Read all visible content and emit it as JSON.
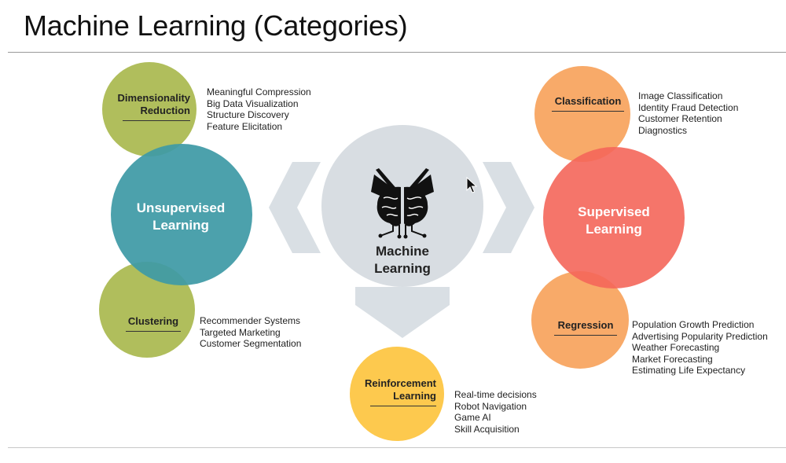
{
  "header": {
    "title": "Machine Learning (Categories)"
  },
  "center": {
    "label_line1": "Machine",
    "label_line2": "Learning",
    "icon": "brain-book-icon"
  },
  "unsupervised": {
    "label_line1": "Unsupervised",
    "label_line2": "Learning",
    "dimensionality": {
      "label_line1": "Dimensionality",
      "label_line2": "Reduction",
      "items": [
        "Meaningful Compression",
        "Big Data Visualization",
        "Structure Discovery",
        "Feature Elicitation"
      ]
    },
    "clustering": {
      "label": "Clustering",
      "items": [
        "Recommender Systems",
        "Targeted Marketing",
        "Customer Segmentation"
      ]
    }
  },
  "supervised": {
    "label_line1": "Supervised",
    "label_line2": "Learning",
    "classification": {
      "label": "Classification",
      "items": [
        "Image Classification",
        "Identity Fraud Detection",
        "Customer Retention",
        "Diagnostics"
      ]
    },
    "regression": {
      "label": "Regression",
      "items": [
        "Population Growth Prediction",
        "Advertising Popularity Prediction",
        "Weather Forecasting",
        "Market Forecasting",
        "Estimating Life Expectancy"
      ]
    }
  },
  "reinforcement": {
    "label_line1": "Reinforcement",
    "label_line2": "Learning",
    "items": [
      "Real-time decisions",
      "Robot Navigation",
      "Game AI",
      "Skill Acquisition"
    ]
  },
  "colors": {
    "green": "#a9b84e",
    "teal": "#3e9aa6",
    "orange": "#f7a35c",
    "red": "#f4665a",
    "yellow": "#fdc94e",
    "gray_circle": "#d8dde2",
    "arrow": "#d5dbe1"
  }
}
